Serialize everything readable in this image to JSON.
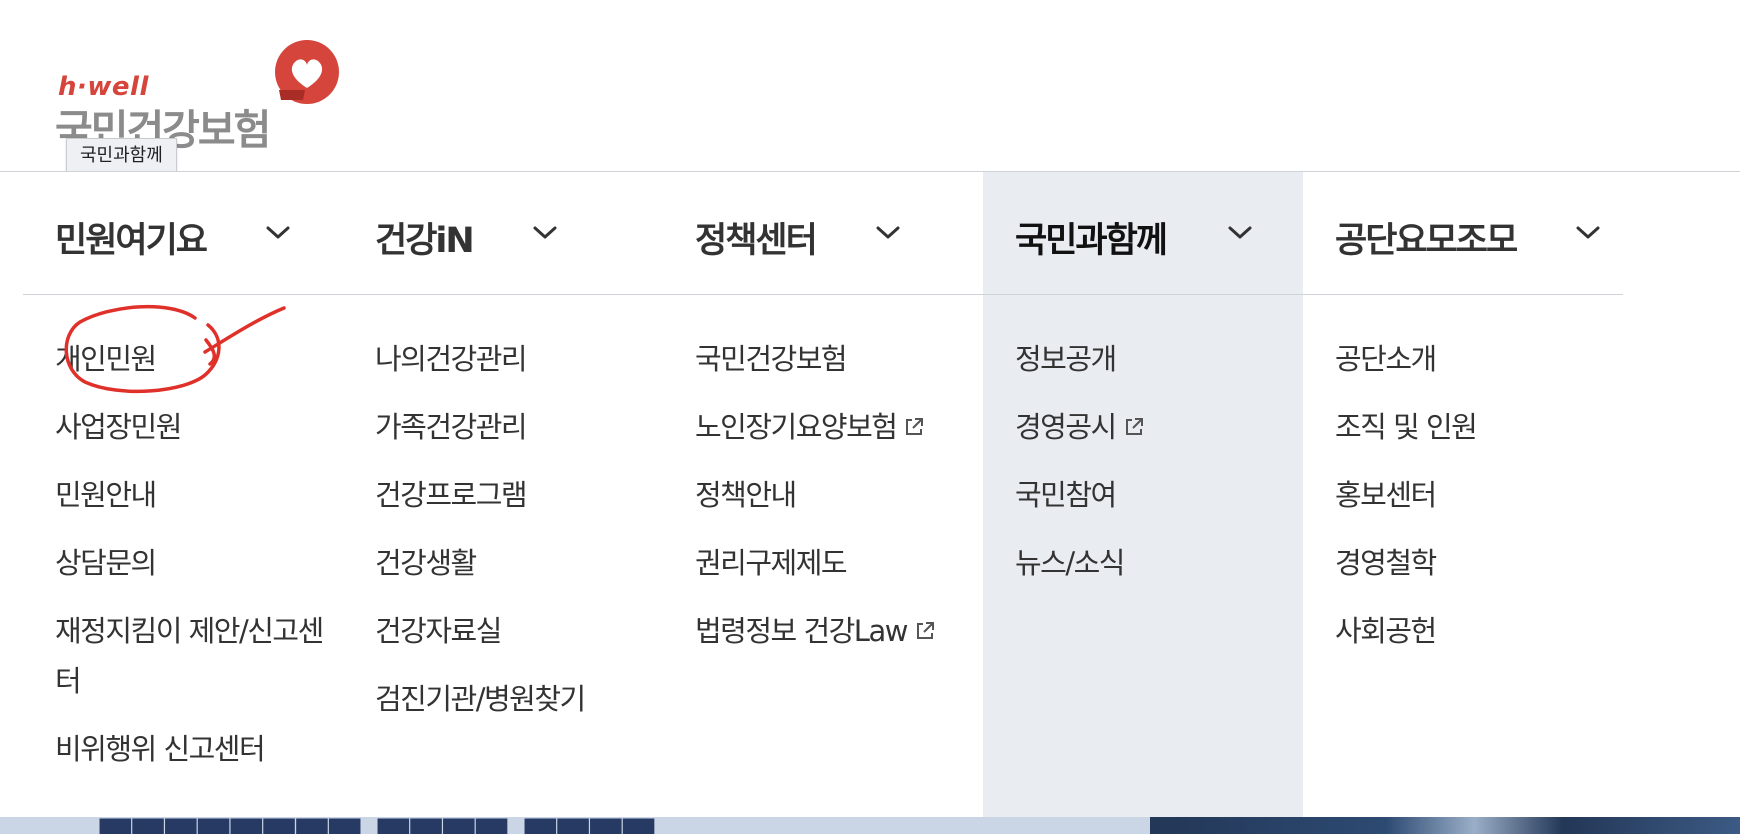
{
  "logo": {
    "brand": "h·well",
    "name": "국민건강보험"
  },
  "tooltip": "국민과함께",
  "menu": {
    "columns": [
      {
        "title": "민원여기요",
        "active": false,
        "items": [
          {
            "label": "개인민원",
            "external": false
          },
          {
            "label": "사업장민원",
            "external": false
          },
          {
            "label": "민원안내",
            "external": false
          },
          {
            "label": "상담문의",
            "external": false
          },
          {
            "label": "재정지킴이 제안/신고센터",
            "external": false
          },
          {
            "label": "비위행위 신고센터",
            "external": false
          }
        ]
      },
      {
        "title": "건강iN",
        "active": false,
        "items": [
          {
            "label": "나의건강관리",
            "external": false
          },
          {
            "label": "가족건강관리",
            "external": false
          },
          {
            "label": "건강프로그램",
            "external": false
          },
          {
            "label": "건강생활",
            "external": false
          },
          {
            "label": "건강자료실",
            "external": false
          },
          {
            "label": "검진기관/병원찾기",
            "external": false
          }
        ]
      },
      {
        "title": "정책센터",
        "active": false,
        "items": [
          {
            "label": "국민건강보험",
            "external": false
          },
          {
            "label": "노인장기요양보험",
            "external": true
          },
          {
            "label": "정책안내",
            "external": false
          },
          {
            "label": "권리구제제도",
            "external": false
          },
          {
            "label": "법령정보 건강Law",
            "external": true
          }
        ]
      },
      {
        "title": "국민과함께",
        "active": true,
        "items": [
          {
            "label": "정보공개",
            "external": false
          },
          {
            "label": "경영공시",
            "external": true
          },
          {
            "label": "국민참여",
            "external": false
          },
          {
            "label": "뉴스/소식",
            "external": false
          }
        ]
      },
      {
        "title": "공단요모조모",
        "active": false,
        "items": [
          {
            "label": "공단소개",
            "external": false
          },
          {
            "label": "조직 및 인원",
            "external": false
          },
          {
            "label": "홍보센터",
            "external": false
          },
          {
            "label": "경영철학",
            "external": false
          },
          {
            "label": "사회공헌",
            "external": false
          }
        ]
      }
    ]
  },
  "icons": {
    "dropdown": "chevron-down-icon",
    "external": "external-link-icon",
    "logo_mark": "heart-icon"
  },
  "colors": {
    "brand_red": "#d6453b",
    "logo_gray": "#8b8b8b",
    "active_column_bg": "#e9edf2",
    "annotation_red": "#e0302a"
  }
}
